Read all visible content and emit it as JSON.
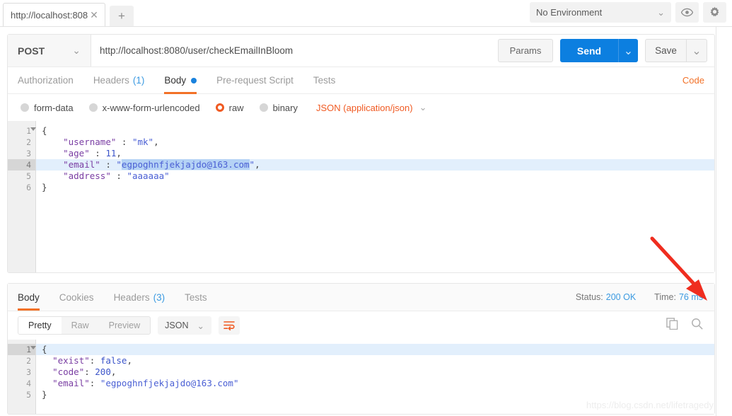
{
  "tabstrip": {
    "request_tab_label": "http://localhost:808",
    "close_icon": "close-icon",
    "new_tab_label": "+",
    "environment": {
      "selected": "No Environment",
      "caret": "⌄",
      "eye_icon": "eye-icon",
      "gear_icon": "gear-icon"
    }
  },
  "request": {
    "method": "POST",
    "method_caret": "⌄",
    "url": "http://localhost:8080/user/checkEmailInBloom",
    "url_placeholder": "Enter request URL",
    "params_label": "Params",
    "send_label": "Send",
    "send_caret": "⌄",
    "save_label": "Save",
    "save_caret": "⌄",
    "tabs": [
      {
        "label": "Authorization",
        "count": "",
        "active": false
      },
      {
        "label": "Headers",
        "count": "(1)",
        "active": false
      },
      {
        "label": "Body",
        "count": "",
        "active": true
      },
      {
        "label": "Pre-request Script",
        "count": "",
        "active": false
      },
      {
        "label": "Tests",
        "count": "",
        "active": false
      }
    ],
    "code_link": "Code",
    "body_types": [
      {
        "label": "form-data",
        "selected": false
      },
      {
        "label": "x-www-form-urlencoded",
        "selected": false
      },
      {
        "label": "raw",
        "selected": true
      },
      {
        "label": "binary",
        "selected": false
      }
    ],
    "content_type": "JSON (application/json)",
    "content_type_caret": "⌄",
    "body_editor": {
      "current_line": 4,
      "lines": [
        {
          "no": "1",
          "text": "{",
          "fold": true
        },
        {
          "no": "2",
          "text": "    \"username\" : \"mk\","
        },
        {
          "no": "3",
          "text": "    \"age\" : 11,"
        },
        {
          "no": "4",
          "text": "    \"email\" : \"egpoghnfjekjajdo@163.com\","
        },
        {
          "no": "5",
          "text": "    \"address\" : \"aaaaaa\""
        },
        {
          "no": "6",
          "text": "}"
        }
      ],
      "selected_text": "egpoghnfjekjajdo@163.com"
    }
  },
  "response": {
    "tabs": [
      {
        "label": "Body",
        "count": "",
        "active": true
      },
      {
        "label": "Cookies",
        "count": "",
        "active": false
      },
      {
        "label": "Headers",
        "count": "(3)",
        "active": false
      },
      {
        "label": "Tests",
        "count": "",
        "active": false
      }
    ],
    "status_label": "Status:",
    "status_value": "200 OK",
    "time_label": "Time:",
    "time_value": "76 ms",
    "view_modes": [
      {
        "label": "Pretty",
        "active": true
      },
      {
        "label": "Raw",
        "active": false
      },
      {
        "label": "Preview",
        "active": false
      }
    ],
    "format": "JSON",
    "format_caret": "⌄",
    "wrap_icon": "word-wrap-icon",
    "copy_icon": "copy-icon",
    "search_icon": "search-icon",
    "body_editor": {
      "current_line": 1,
      "lines": [
        {
          "no": "1",
          "text": "{",
          "fold": true
        },
        {
          "no": "2",
          "text": "  \"exist\": false,"
        },
        {
          "no": "3",
          "text": "  \"code\": 200,"
        },
        {
          "no": "4",
          "text": "  \"email\": \"egpoghnfjekjajdo@163.com\""
        },
        {
          "no": "5",
          "text": "}"
        }
      ]
    }
  },
  "annotation": {
    "arrow_color": "#ef2d1f"
  },
  "watermark": "https://blog.csdn.net/lifetragedy",
  "colors": {
    "accent_orange": "#f05a22",
    "send_blue": "#0c7fe0",
    "link_blue": "#3b9ae1"
  }
}
